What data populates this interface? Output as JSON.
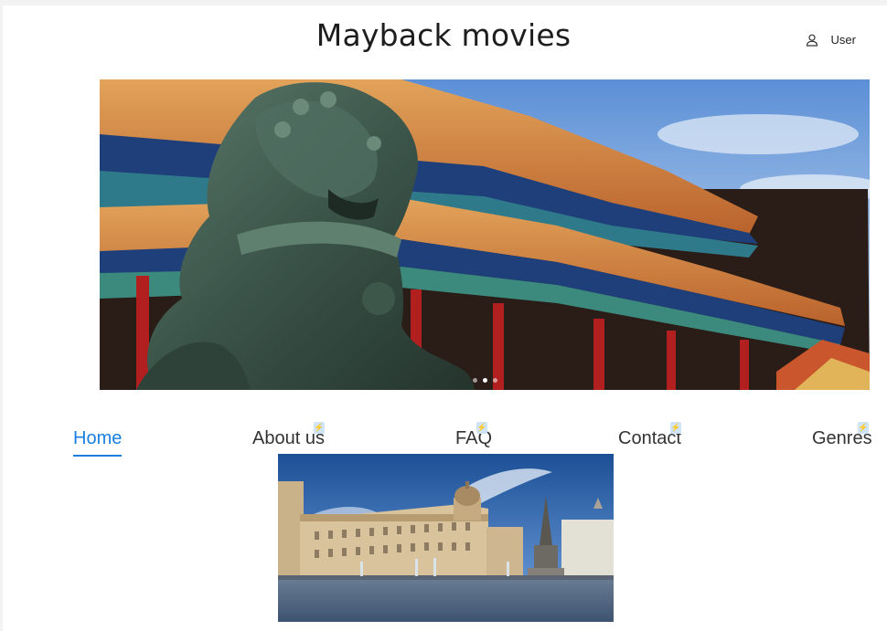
{
  "header": {
    "site_title": "Mayback movies",
    "user_label": "User",
    "user_icon": "person-icon"
  },
  "hero": {
    "image_icon": "palace-lion-image",
    "slides_count": 3,
    "active_slide": 1
  },
  "nav": {
    "items": [
      {
        "label": "Home",
        "active": true
      },
      {
        "label": "About us",
        "active": false
      },
      {
        "label": "FAQ",
        "active": false
      },
      {
        "label": "Contact",
        "active": false
      },
      {
        "label": "Genres",
        "active": false
      }
    ],
    "badge_icon": "lightning-icon",
    "accent_color": "#1a7fe0"
  },
  "feature": {
    "image_icon": "city-square-image"
  }
}
